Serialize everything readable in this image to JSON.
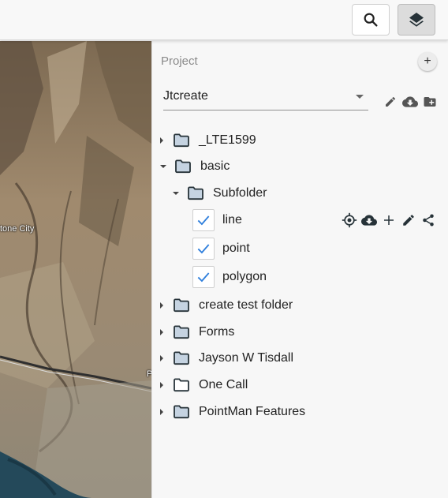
{
  "toolbar": {
    "search_icon": "search-icon",
    "layers_icon": "layers-icon"
  },
  "map": {
    "city_label": "tone City",
    "edge_label": "P"
  },
  "panel": {
    "title": "Project",
    "add_icon": "plus-icon",
    "project_select": {
      "value": "Jtcreate"
    },
    "project_actions": [
      "edit-icon",
      "cloud-download-icon",
      "create-new-folder-icon"
    ]
  },
  "tree": [
    {
      "label": "_LTE1599",
      "type": "folder",
      "expanded": false,
      "filled": true
    },
    {
      "label": "basic",
      "type": "folder",
      "expanded": true,
      "filled": true
    },
    {
      "label": "Subfolder",
      "type": "folder",
      "expanded": true,
      "filled": true,
      "level": 1
    },
    {
      "label": "line",
      "type": "layer",
      "checked": true
    },
    {
      "label": "point",
      "type": "layer",
      "checked": true
    },
    {
      "label": "polygon",
      "type": "layer",
      "checked": true
    },
    {
      "label": "create test folder",
      "type": "folder",
      "expanded": false,
      "filled": true
    },
    {
      "label": "Forms",
      "type": "folder",
      "expanded": false,
      "filled": true
    },
    {
      "label": "Jayson W Tisdall",
      "type": "folder",
      "expanded": false,
      "filled": true
    },
    {
      "label": "One Call",
      "type": "folder",
      "expanded": false,
      "filled": false
    },
    {
      "label": "PointMan Features",
      "type": "folder",
      "expanded": false,
      "filled": true
    }
  ],
  "layer_actions": [
    "my-location-icon",
    "cloud-download-icon",
    "plus-icon",
    "edit-icon",
    "share-icon"
  ],
  "colors": {
    "folder_fill": "#c5d3e1",
    "folder_stroke": "#263238",
    "check_color": "#2f7fdc",
    "panel_bg": "#f7f7f7"
  }
}
